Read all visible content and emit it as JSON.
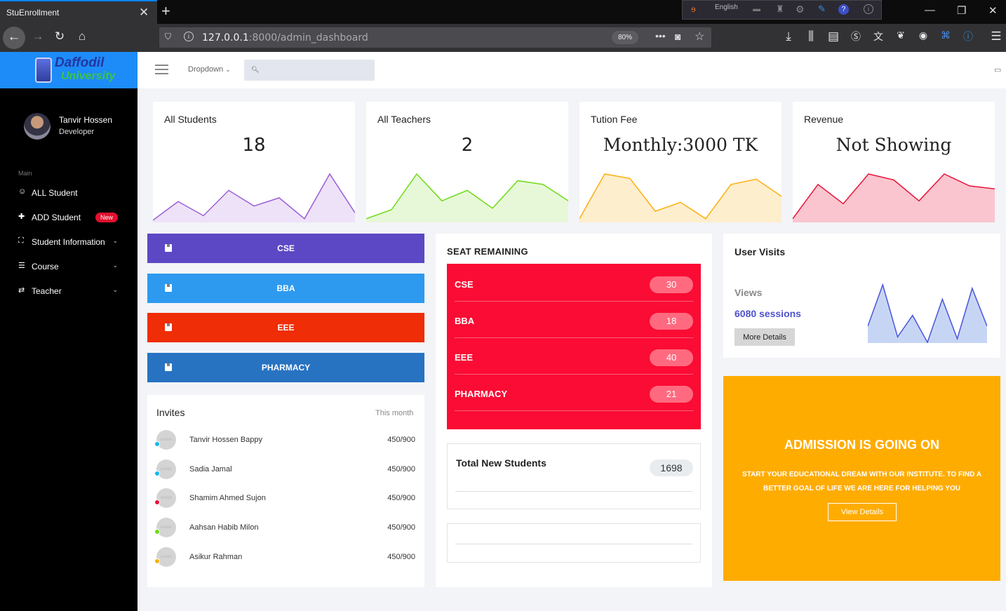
{
  "browser": {
    "tab_title": "StuEnrollment",
    "url_host": "127.0.0.1",
    "url_rest": ":8000/admin_dashboard",
    "zoom": "80%",
    "language": "English"
  },
  "brand": {
    "line1": "Daffodil",
    "line2": "University"
  },
  "user": {
    "name": "Tanvir Hossen",
    "role": "Developer"
  },
  "sidebar": {
    "section_label": "Main",
    "badge": "New",
    "items": [
      {
        "label": "ALL Student",
        "icon": "user-circle-icon"
      },
      {
        "label": "ADD Student",
        "icon": "puzzle-icon"
      },
      {
        "label": "Student Information",
        "icon": "expand-icon"
      },
      {
        "label": "Course",
        "icon": "list-icon"
      },
      {
        "label": "Teacher",
        "icon": "swap-icon"
      }
    ]
  },
  "topbar": {
    "dropdown": "Dropdown",
    "search_placeholder": ""
  },
  "stats": [
    {
      "title": "All Students",
      "value": "18",
      "color": "#9a5ed6",
      "fill": "#eee2f8",
      "spark": [
        2,
        27,
        8,
        42,
        21,
        32,
        4,
        64,
        12
      ]
    },
    {
      "title": "All Teachers",
      "value": "2",
      "color": "#6fdc16",
      "fill": "#e7f8d8",
      "spark": [
        4,
        16,
        64,
        28,
        42,
        18,
        55,
        50,
        28
      ]
    },
    {
      "title": "Tution Fee",
      "value": "Monthly:3000 TK",
      "color": "#fcaf0f",
      "fill": "#fdeecd",
      "spark": [
        4,
        64,
        58,
        14,
        26,
        4,
        50,
        57,
        34
      ]
    },
    {
      "title": "Revenue",
      "value": "Not Showing",
      "color": "#e8143a",
      "fill": "#fac5cf",
      "spark": [
        4,
        50,
        24,
        64,
        56,
        28,
        64,
        48,
        44
      ]
    }
  ],
  "courses": [
    {
      "label": "CSE",
      "color": "#5c48c4"
    },
    {
      "label": "BBA",
      "color": "#2d9af0"
    },
    {
      "label": "EEE",
      "color": "#ef2d06"
    },
    {
      "label": "PHARMACY",
      "color": "#2773c2"
    }
  ],
  "invites": {
    "title": "Invites",
    "period": "This month",
    "people": [
      {
        "name": "Tanvir Hossen Bappy",
        "value": "450/900",
        "dot": "#18b6f0"
      },
      {
        "name": "Sadia Jamal",
        "value": "450/900",
        "dot": "#18b6f0"
      },
      {
        "name": "Shamim Ahmed Sujon",
        "value": "450/900",
        "dot": "#e8143a"
      },
      {
        "name": "Aahsan Habib Milon",
        "value": "450/900",
        "dot": "#6fdc16"
      },
      {
        "name": "Asikur Rahman",
        "value": "450/900",
        "dot": "#fcaf0f"
      }
    ]
  },
  "seats": {
    "title": "SEAT REMAINING",
    "rows": [
      {
        "course": "CSE",
        "value": "30"
      },
      {
        "course": "BBA",
        "value": "18"
      },
      {
        "course": "EEE",
        "value": "40"
      },
      {
        "course": "PHARMACY",
        "value": "21"
      }
    ],
    "total_label": "Total New Students",
    "total_value": "1698"
  },
  "visits": {
    "title": "User Visits",
    "views_label": "Views",
    "sessions": "6080 sessions",
    "button": "More Details",
    "spark": [
      18,
      64,
      6,
      30,
      0,
      48,
      4,
      60,
      18
    ]
  },
  "admission": {
    "title": "ADMISSION IS GOING ON",
    "text": "START YOUR EDUCATIONAL DREAM WITH OUR INSTITUTE. TO FIND A BETTER GOAL OF LIFE WE ARE HERE FOR HELPING YOU",
    "button": "View Details"
  }
}
